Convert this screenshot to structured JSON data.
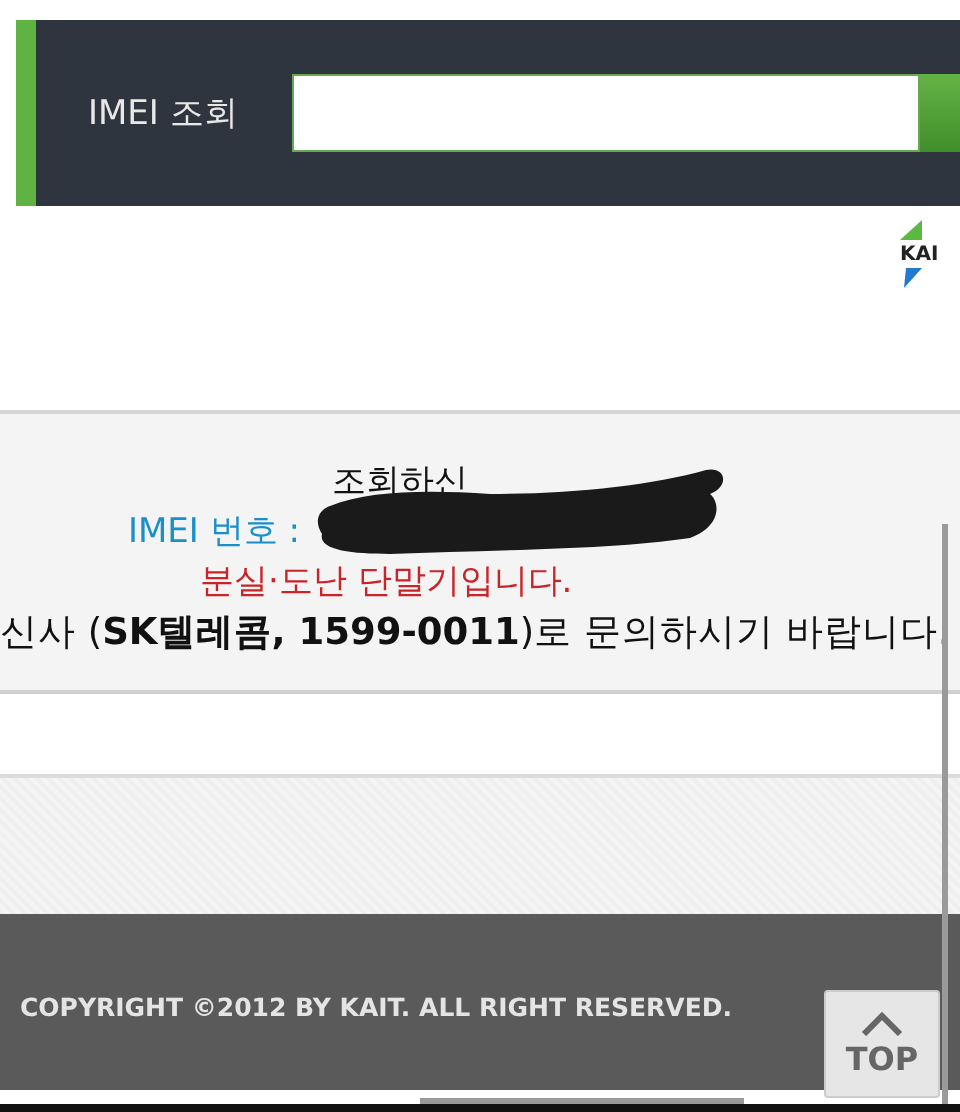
{
  "search": {
    "label": "IMEI 조회"
  },
  "logo": {
    "text": "KAI"
  },
  "result": {
    "lines": [
      {
        "kind": "intro",
        "text": "조회하신"
      },
      {
        "kind": "imei",
        "text": "IMEI 번호 :"
      },
      {
        "kind": "warning",
        "text": "분실·도난 단말기입니다."
      },
      {
        "kind": "contact",
        "text": "신사 (**SK텔레콤, 1599-0011**)로 문의하시기 바랍니다."
      }
    ]
  },
  "footer": {
    "copyright": "COPYRIGHT ©2012 BY KAIT. ALL RIGHT RESERVED.",
    "top_button": "TOP"
  }
}
